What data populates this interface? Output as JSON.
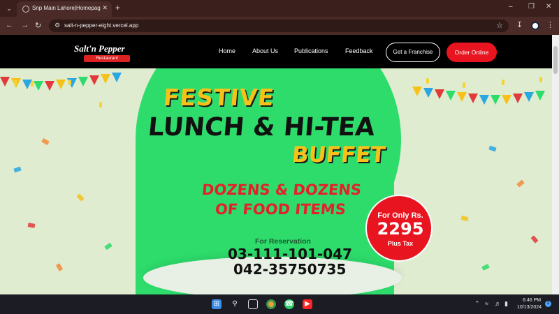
{
  "browser": {
    "tab_title": "Snp Main Lahore|Homepag",
    "url": "salt-n-pepper-eight.vercel.app",
    "icons": {
      "tab_list": "chevron-down-icon",
      "favicon": "globe-icon",
      "close": "close-icon",
      "new_tab": "plus-icon",
      "back": "back-icon",
      "forward": "forward-icon",
      "reload": "reload-icon",
      "site_info": "site-info-icon",
      "bookmark": "star-icon",
      "download": "download-icon",
      "profile": "profile-icon",
      "menu": "kebab-menu-icon",
      "minimize": "minimize-icon",
      "maximize": "maximize-icon",
      "close_window": "close-window-icon"
    }
  },
  "site": {
    "logo": {
      "name": "Salt'n Pepper",
      "sub": "Restaurant"
    },
    "nav": {
      "home": "Home",
      "about": "About Us",
      "publications": "Publications",
      "feedback": "Feedback"
    },
    "franchise_button": "Get a Franchise",
    "order_button": "Order Online",
    "brand_red": "#e8141f",
    "accent_green": "#2ddc6b"
  },
  "hero": {
    "line1": "FESTIVE",
    "line2": "LUNCH & HI-TEA",
    "line3": "BUFFET",
    "line4": "DOZENS & DOZENS",
    "line5": "OF FOOD ITEMS",
    "reservation_label": "For Reservation",
    "phone1": "03-111-101-047",
    "phone2": "042-35750735",
    "price_prefix": "For Only Rs.",
    "price": "2295",
    "price_suffix": "Plus Tax"
  },
  "taskbar": {
    "time": "6:46 PM",
    "date": "10/13/2024",
    "notification_count": "2",
    "icons": [
      "windows-start-icon",
      "search-icon",
      "task-view-icon",
      "chrome-icon",
      "whatsapp-icon",
      "youtube-icon"
    ]
  }
}
